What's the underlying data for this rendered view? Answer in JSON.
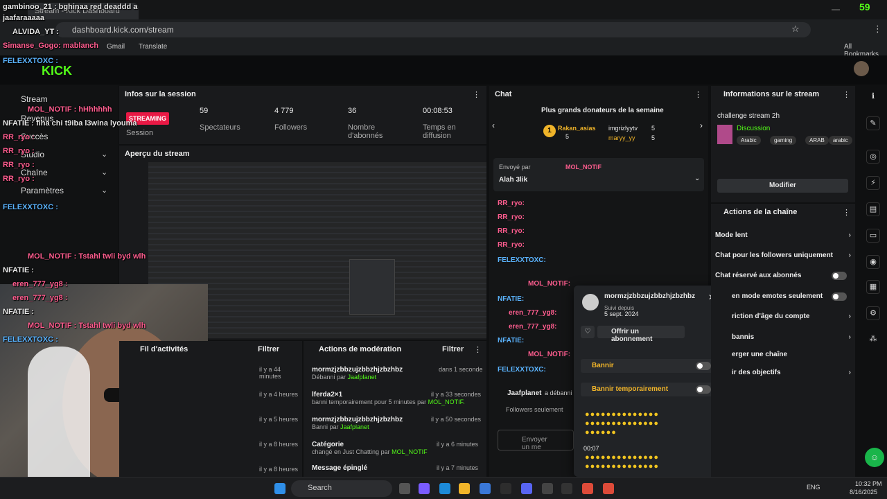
{
  "browser": {
    "tab_title": "Stream - Kick Dashboard",
    "url": "dashboard.kick.com/stream",
    "bookmarks": [
      "Gmail",
      "Translate"
    ],
    "all_bookmarks": "All Bookmarks",
    "kick_score": "59"
  },
  "nav": {
    "items": [
      "Stream",
      "Revenus",
      "Succès",
      "Studio",
      "Chaîne",
      "Paramètres"
    ]
  },
  "session": {
    "title": "Infos sur la session",
    "badge": "STREAMING",
    "stats": [
      {
        "value": "59",
        "label": "Spectateurs"
      },
      {
        "value": "4 779",
        "label": "Followers"
      },
      {
        "value": "36",
        "label": "Nombre d'abonnés"
      },
      {
        "value": "00:08:53",
        "label": "Temps en diffusion"
      }
    ],
    "session_label": "Session"
  },
  "preview": {
    "title": "Aperçu du stream"
  },
  "activity": {
    "title": "Fil d'activités",
    "filter": "Filtrer",
    "times": [
      "il y a 44 minutes",
      "il y a 4 heures",
      "il y a 5 heures",
      "il y a 8 heures",
      "il y a 8 heures"
    ]
  },
  "modactions": {
    "title": "Actions de modération",
    "filter": "Filtrer",
    "rows": [
      {
        "title": "mormzjzbbzujzbbzhjzbzhbz",
        "sub": "Débanni par ",
        "by": "Jaafplanet",
        "time": "dans 1 seconde"
      },
      {
        "title": "lferda2×1",
        "sub": "banni temporairement pour 5 minutes par ",
        "by": "MOL_NOTIF.",
        "time": "il y a 33 secondes"
      },
      {
        "title": "mormzjzbbzujzbbzhjzbzhbz",
        "sub": "Banni par ",
        "by": "Jaafplanet",
        "time": "il y a 50 secondes"
      },
      {
        "title": "Catégorie",
        "sub": "changé en Just Chatting par ",
        "by": "MOL_NOTIF",
        "time": "il y a 6 minutes"
      },
      {
        "title": "Message épinglé",
        "sub": "",
        "by": "",
        "time": "il y a 7 minutes"
      }
    ]
  },
  "chat": {
    "title": "Chat",
    "donors_title": "Plus grands donateurs de la semaine",
    "donors": [
      {
        "rank": "1",
        "name": "Rakan_asias",
        "count": "5"
      },
      {
        "name": "imgrizlyytv",
        "count": "5"
      },
      {
        "name": "maryy_yy",
        "count": "5"
      }
    ],
    "pinned_by": "Envoyé par",
    "pinned_user": "MOL_NOTIF",
    "pinned_msg": "Alah 3lik",
    "messages": [
      "RR_ryo:",
      "RR_ryo:",
      "RR_ryo:",
      "RR_ryo:",
      "FELEXXTOXC:",
      "MOL_NOTIF:",
      "NFATIE:",
      "eren_777_yg8:",
      "eren_777_yg8:",
      "NFATIE:",
      "MOL_NOTIF:",
      "FELEXXTOXC:"
    ],
    "unban_user": "Jaafplanet",
    "unban_text": "a débanni m",
    "followers_only": "Followers seulement",
    "input_placeholder": "Envoyer un me"
  },
  "popup": {
    "username": "mormzjzbbzujzbbzhjzbzhbz",
    "follow_label": "Suivi depuis",
    "follow_date": "5 sept. 2024",
    "gift": "Offrir un abonnement",
    "ban": "Bannir",
    "tempban": "Bannir temporairement",
    "timer": "00:07"
  },
  "info": {
    "title": "Informations sur le stream",
    "stream_title": "challenge stream 2h",
    "category": "Discussion",
    "tags": [
      "Arabic",
      "gaming",
      "ARAB",
      "arabic"
    ],
    "edit": "Modifier"
  },
  "actions": {
    "title": "Actions de la chaîne",
    "rows": [
      "Mode lent",
      "Chat pour les followers uniquement",
      "Chat réservé aux abonnés",
      "en mode emotes seulement",
      "riction d'âge du compte",
      "bannis",
      "erger une chaîne",
      "ir des objectifs"
    ]
  },
  "overlay": {
    "lines": [
      "gambinoo_21 : bghinaa red deaddd a",
      "jaafaraaaaa",
      "ALVIDA_YT :",
      "Simanse_Gogo: mablanch",
      "FELEXXTOXC :",
      "MOL_NOTIF : hHhhhhh",
      "NFATIE : fiha chi t9iba l3wina lyouma",
      "RR_ryo :",
      "RR_ryo :",
      "RR_ryo :",
      "RR_ryo :",
      "FELEXXTOXC :",
      "MOL_NOTIF : Tstahl twli byd wlh",
      "NFATIE :",
      "eren_777_yg8 :",
      "eren_777_yg8 :",
      "NFATIE :",
      "MOL_NOTIF : Tstahl twli byd wlh",
      "FELEXXTOXC :"
    ]
  },
  "taskbar": {
    "search": "Search",
    "lang": "ENG",
    "time": "10:32 PM",
    "date": "8/16/2025"
  }
}
